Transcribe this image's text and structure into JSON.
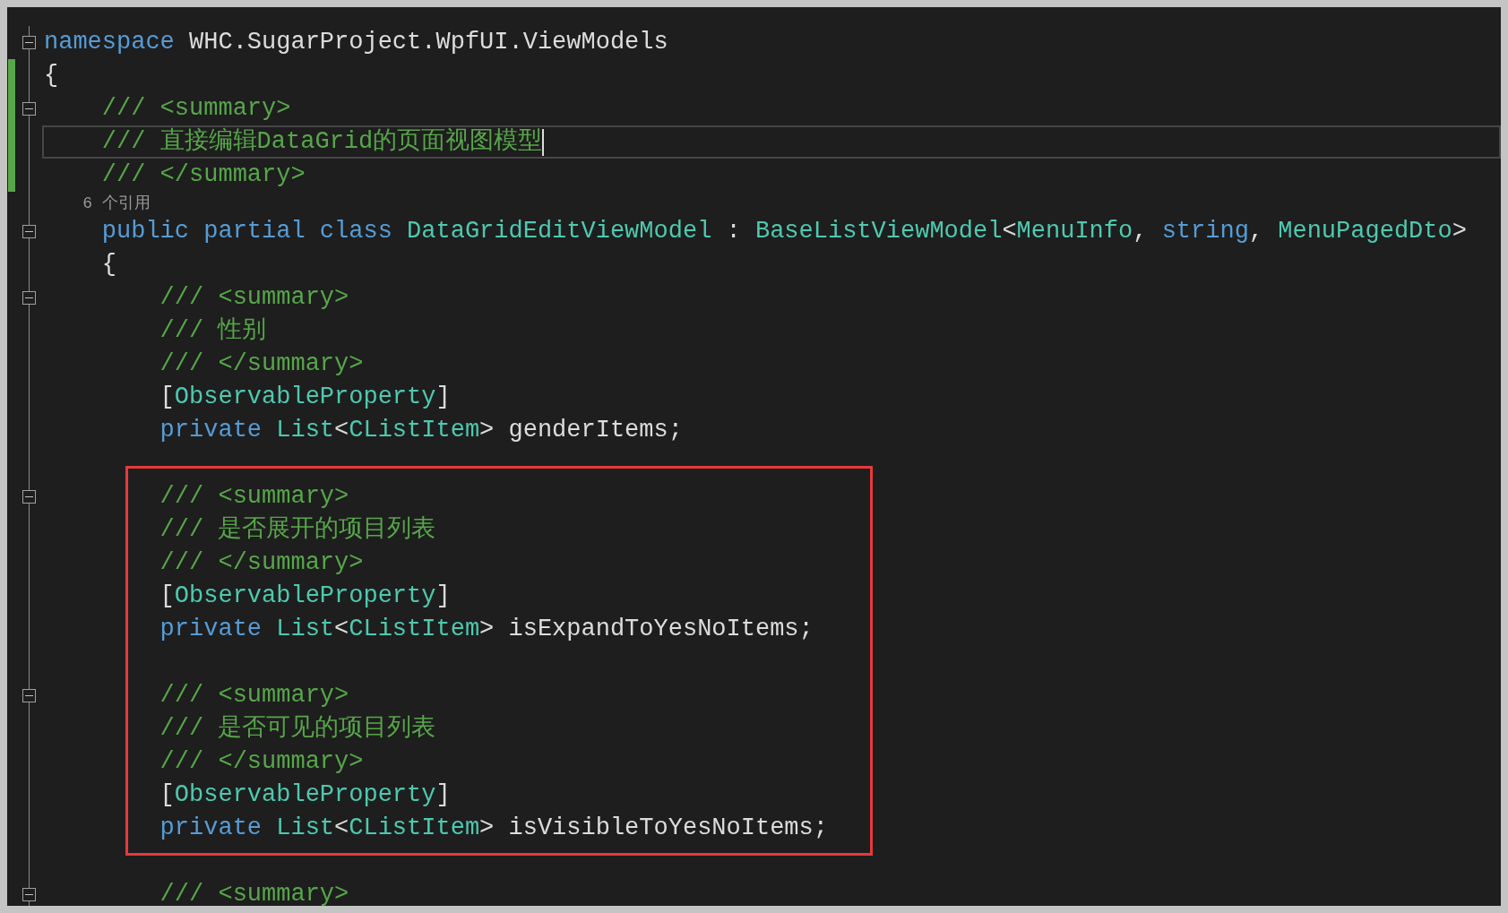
{
  "editor": {
    "blocks": [
      {
        "highlighted": false,
        "lines": [
          {
            "kind": "code",
            "foldable": true,
            "changed": false,
            "current": false,
            "tokens": [
              {
                "text": "namespace",
                "kind": "keyword"
              },
              {
                "text": " WHC.SugarProject.WpfUI.ViewModels",
                "kind": "plain"
              }
            ]
          },
          {
            "kind": "code",
            "foldable": false,
            "changed": true,
            "current": false,
            "tokens": [
              {
                "text": "{",
                "kind": "plain"
              }
            ]
          },
          {
            "kind": "code",
            "foldable": true,
            "changed": true,
            "current": false,
            "tokens": [
              {
                "text": "    /// <summary>",
                "kind": "comment"
              }
            ]
          },
          {
            "kind": "code",
            "foldable": false,
            "changed": true,
            "current": true,
            "tokens": [
              {
                "text": "    /// 直接编辑DataGrid的页面视图模型",
                "kind": "comment"
              }
            ]
          },
          {
            "kind": "code",
            "foldable": false,
            "changed": true,
            "current": false,
            "tokens": [
              {
                "text": "    /// </summary>",
                "kind": "comment"
              }
            ]
          },
          {
            "kind": "codelens",
            "foldable": false,
            "changed": false,
            "current": false,
            "tokens": [
              {
                "text": "    6 个引用",
                "kind": "lens"
              }
            ]
          },
          {
            "kind": "code",
            "foldable": true,
            "changed": false,
            "current": false,
            "tokens": [
              {
                "text": "    public partial class",
                "kind": "keyword"
              },
              {
                "text": " DataGridEditViewModel",
                "kind": "type"
              },
              {
                "text": " : ",
                "kind": "plain"
              },
              {
                "text": "BaseListViewModel",
                "kind": "type"
              },
              {
                "text": "<",
                "kind": "plain"
              },
              {
                "text": "MenuInfo",
                "kind": "type"
              },
              {
                "text": ", ",
                "kind": "plain"
              },
              {
                "text": "string",
                "kind": "keyword"
              },
              {
                "text": ", ",
                "kind": "plain"
              },
              {
                "text": "MenuPagedDto",
                "kind": "type"
              },
              {
                "text": ">",
                "kind": "plain"
              }
            ]
          },
          {
            "kind": "code",
            "foldable": false,
            "changed": false,
            "current": false,
            "tokens": [
              {
                "text": "    {",
                "kind": "plain"
              }
            ]
          },
          {
            "kind": "code",
            "foldable": true,
            "changed": false,
            "current": false,
            "tokens": [
              {
                "text": "        /// <summary>",
                "kind": "comment"
              }
            ]
          },
          {
            "kind": "code",
            "foldable": false,
            "changed": false,
            "current": false,
            "tokens": [
              {
                "text": "        /// 性别",
                "kind": "comment"
              }
            ]
          },
          {
            "kind": "code",
            "foldable": false,
            "changed": false,
            "current": false,
            "tokens": [
              {
                "text": "        /// </summary>",
                "kind": "comment"
              }
            ]
          },
          {
            "kind": "code",
            "foldable": false,
            "changed": false,
            "current": false,
            "tokens": [
              {
                "text": "        [",
                "kind": "plain"
              },
              {
                "text": "ObservableProperty",
                "kind": "type"
              },
              {
                "text": "]",
                "kind": "plain"
              }
            ]
          },
          {
            "kind": "code",
            "foldable": false,
            "changed": false,
            "current": false,
            "tokens": [
              {
                "text": "        private",
                "kind": "keyword"
              },
              {
                "text": " List",
                "kind": "type"
              },
              {
                "text": "<",
                "kind": "plain"
              },
              {
                "text": "CListItem",
                "kind": "type"
              },
              {
                "text": "> genderItems;",
                "kind": "plain"
              }
            ]
          },
          {
            "kind": "blank"
          }
        ]
      },
      {
        "highlighted": true,
        "lines": [
          {
            "kind": "code",
            "foldable": true,
            "changed": false,
            "current": false,
            "tokens": [
              {
                "text": "        /// <summary>",
                "kind": "comment"
              }
            ]
          },
          {
            "kind": "code",
            "foldable": false,
            "changed": false,
            "current": false,
            "tokens": [
              {
                "text": "        /// 是否展开的项目列表",
                "kind": "comment"
              }
            ]
          },
          {
            "kind": "code",
            "foldable": false,
            "changed": false,
            "current": false,
            "tokens": [
              {
                "text": "        /// </summary>",
                "kind": "comment"
              }
            ]
          },
          {
            "kind": "code",
            "foldable": false,
            "changed": false,
            "current": false,
            "tokens": [
              {
                "text": "        [",
                "kind": "plain"
              },
              {
                "text": "ObservableProperty",
                "kind": "type"
              },
              {
                "text": "]",
                "kind": "plain"
              }
            ]
          },
          {
            "kind": "code",
            "foldable": false,
            "changed": false,
            "current": false,
            "tokens": [
              {
                "text": "        private",
                "kind": "keyword"
              },
              {
                "text": " List",
                "kind": "type"
              },
              {
                "text": "<",
                "kind": "plain"
              },
              {
                "text": "CListItem",
                "kind": "type"
              },
              {
                "text": "> isExpandToYesNoItems;",
                "kind": "plain"
              }
            ]
          },
          {
            "kind": "blank"
          },
          {
            "kind": "code",
            "foldable": true,
            "changed": false,
            "current": false,
            "tokens": [
              {
                "text": "        /// <summary>",
                "kind": "comment"
              }
            ]
          },
          {
            "kind": "code",
            "foldable": false,
            "changed": false,
            "current": false,
            "tokens": [
              {
                "text": "        /// 是否可见的项目列表",
                "kind": "comment"
              }
            ]
          },
          {
            "kind": "code",
            "foldable": false,
            "changed": false,
            "current": false,
            "tokens": [
              {
                "text": "        /// </summary>",
                "kind": "comment"
              }
            ]
          },
          {
            "kind": "code",
            "foldable": false,
            "changed": false,
            "current": false,
            "tokens": [
              {
                "text": "        [",
                "kind": "plain"
              },
              {
                "text": "ObservableProperty",
                "kind": "type"
              },
              {
                "text": "]",
                "kind": "plain"
              }
            ]
          },
          {
            "kind": "code",
            "foldable": false,
            "changed": false,
            "current": false,
            "tokens": [
              {
                "text": "        private",
                "kind": "keyword"
              },
              {
                "text": " List",
                "kind": "type"
              },
              {
                "text": "<",
                "kind": "plain"
              },
              {
                "text": "CListItem",
                "kind": "type"
              },
              {
                "text": "> isVisibleToYesNoItems;",
                "kind": "plain"
              }
            ]
          }
        ]
      },
      {
        "highlighted": false,
        "lines": [
          {
            "kind": "blank"
          },
          {
            "kind": "code",
            "foldable": true,
            "changed": false,
            "current": false,
            "tokens": [
              {
                "text": "        /// <summary>",
                "kind": "comment"
              }
            ]
          }
        ]
      }
    ]
  }
}
